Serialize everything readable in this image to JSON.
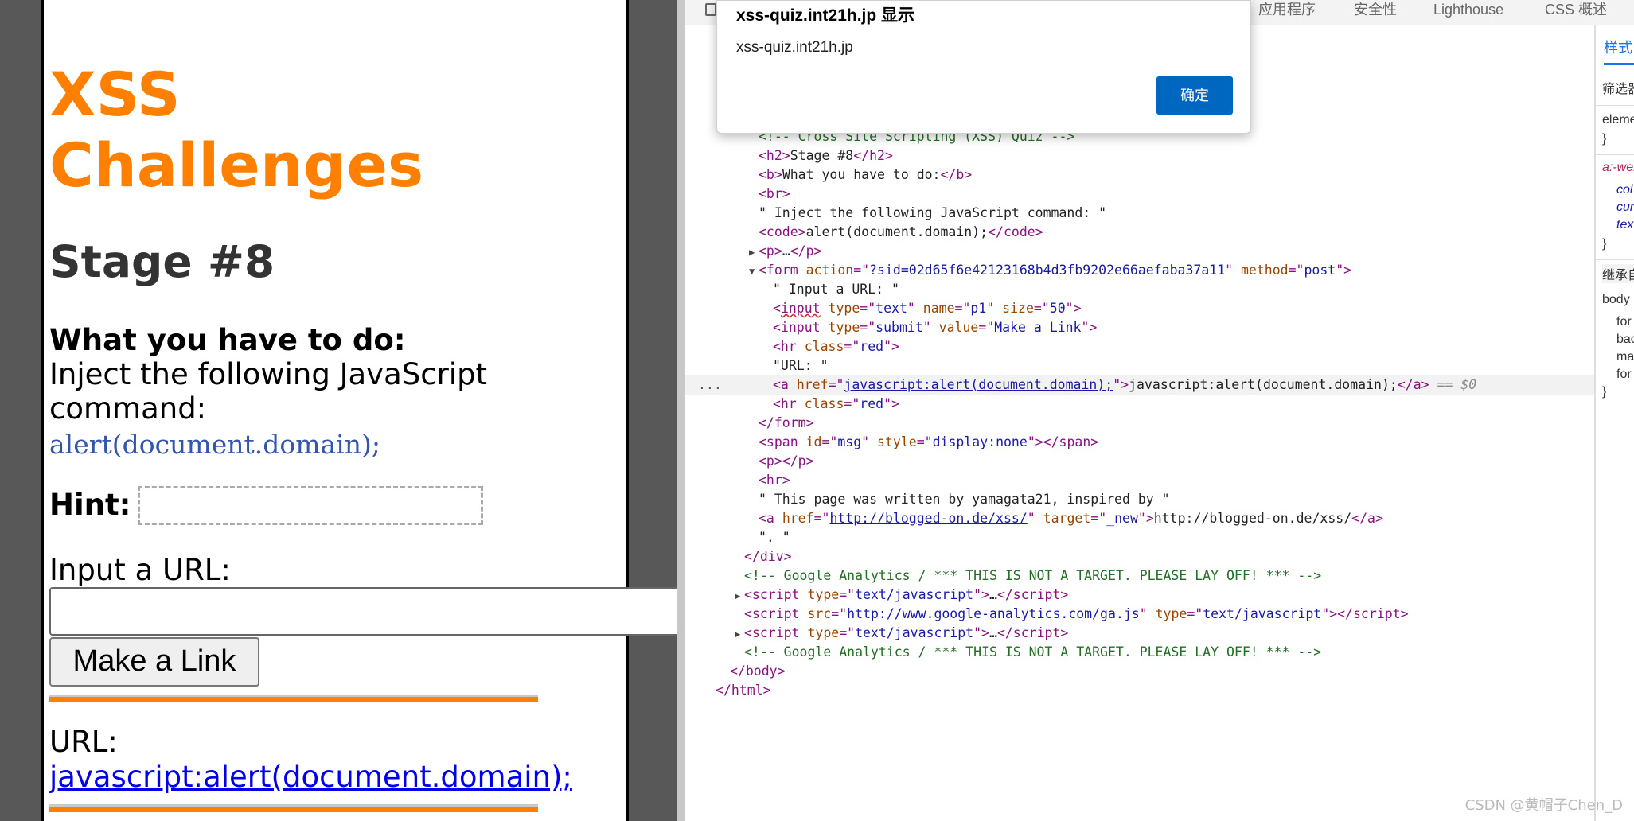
{
  "page": {
    "title": "XSS Challenges",
    "stage": "Stage #8",
    "what_heading": "What you have to do:",
    "inject_text": "Inject the following JavaScript command:",
    "code": "alert(document.domain);",
    "hint_label": "Hint:",
    "input_label": "Input a URL:",
    "input_value": "",
    "submit_label": "Make a Link",
    "url_label": "URL:",
    "link_text": "javascript:alert(document.domain);"
  },
  "devtools": {
    "tabs": [
      "应用程序",
      "安全性",
      "Lighthouse",
      "CSS 概述"
    ],
    "dom": {
      "comment_quiz": "<!-- Cross Site Scripting (XSS) Quiz -->",
      "h2_text": "Stage #8",
      "b_text": "What you have to do:",
      "inject_text": "\" Inject the following JavaScript command: \"",
      "code_text": "alert(document.domain);",
      "p_collapsed": "…",
      "form_action": "?sid=02d65f6e42123168b4d3fb9202e66aefaba37a11",
      "form_method": "post",
      "input_text_label": "\" Input a URL: \"",
      "input_type_text": "text",
      "input_name": "p1",
      "input_size": "50",
      "input_type_submit": "submit",
      "input_value": "Make a Link",
      "hr_class": "red",
      "url_text": "\"URL: \"",
      "a_href": "javascript:alert(document.domain);",
      "a_text": "javascript:alert(document.domain);",
      "selected_marker": "== $0",
      "span_id": "msg",
      "span_style": "display:none",
      "footer_text": "\" This page was written by yamagata21, inspired by \"",
      "footer_href": "http://blogged-on.de/xss/",
      "footer_target": "_new",
      "footer_link_text": "http://blogged-on.de/xss/",
      "period_text": "\". \"",
      "ga_comment": "<!-- Google Analytics / *** THIS IS NOT A TARGET. PLEASE LAY OFF! *** -->",
      "script_type": "text/javascript",
      "script_src": "http://www.google-analytics.com/ga.js",
      "ellipsis": "…"
    },
    "styles_tab": "样式",
    "styles_rows": [
      "筛选器",
      "element",
      "}",
      "a:-web",
      "col",
      "cur",
      "tex",
      "}",
      "继承自",
      "body",
      "for",
      "bac",
      "mar",
      "for",
      "}"
    ]
  },
  "dialog": {
    "title": "xss-quiz.int21h.jp 显示",
    "message": "xss-quiz.int21h.jp",
    "ok_label": "确定"
  },
  "watermark": "CSDN @黄帽子Chen_D"
}
